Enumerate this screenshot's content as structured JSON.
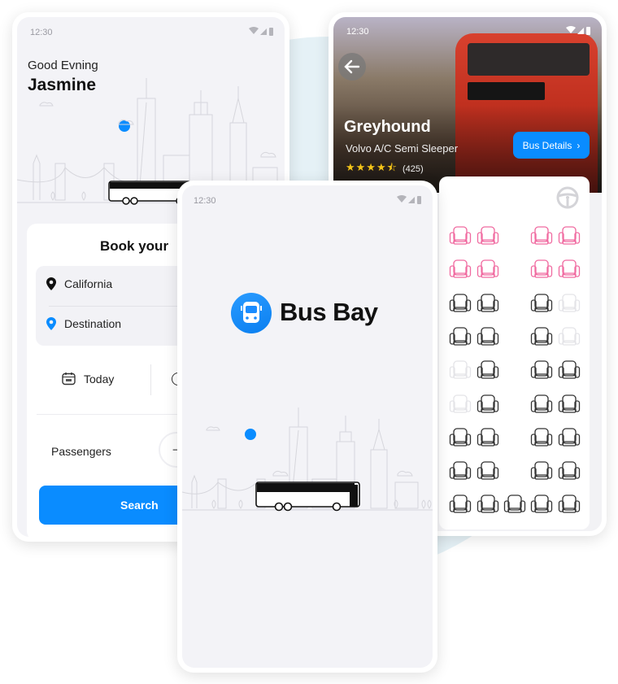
{
  "colors": {
    "accent": "#0a8cff",
    "booked": "#f06aa0",
    "available": "#333333",
    "unavailable": "#e4e4e8",
    "background_circle": "#e5f1f6"
  },
  "home": {
    "status_time": "12:30",
    "greeting": "Good Evning",
    "user_name": "Jasmine",
    "card_title": "Book your",
    "from_value": "California",
    "to_placeholder": "Destination",
    "date_label": "Today",
    "passengers_label": "Passengers",
    "minus_symbol": "−",
    "search_label": "Search"
  },
  "splash": {
    "status_time": "12:30",
    "app_name": "Bus Bay"
  },
  "details": {
    "status_time": "12:30",
    "operator": "Greyhound",
    "bus_type": "Volvo A/C Semi Sleeper",
    "rating": 4.5,
    "reviews": "(425)",
    "details_button": "Bus Details",
    "seat_rows": [
      [
        "booked",
        "booked",
        null,
        "booked",
        "booked"
      ],
      [
        "booked",
        "booked",
        null,
        "booked",
        "booked"
      ],
      [
        "available",
        "available",
        null,
        "available",
        "unavailable"
      ],
      [
        "available",
        "available",
        null,
        "available",
        "unavailable"
      ],
      [
        "unavailable",
        "available",
        null,
        "available",
        "available"
      ],
      [
        "unavailable",
        "available",
        null,
        "available",
        "available"
      ],
      [
        "available",
        "available",
        null,
        "available",
        "available"
      ],
      [
        "available",
        "available",
        null,
        "available",
        "available"
      ],
      [
        "available",
        "available",
        "available",
        "available",
        "available"
      ]
    ]
  }
}
